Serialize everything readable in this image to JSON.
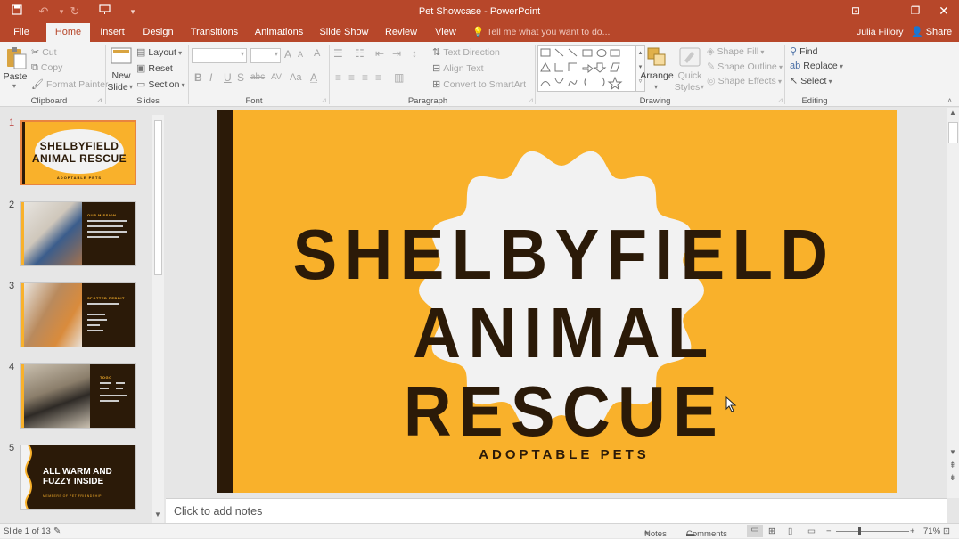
{
  "window": {
    "title": "Pet Showcase - PowerPoint",
    "minimize_glyph": "–",
    "restore_glyph": "❐",
    "close_glyph": "✕",
    "ribbon_options_glyph": "⊡"
  },
  "qat": {
    "save_icon": "save-icon",
    "undo_icon": "undo-icon",
    "redo_icon": "redo-icon",
    "present_icon": "present-from-start-icon",
    "customize_icon": "customize-qat-icon"
  },
  "tabs": [
    {
      "label": "File"
    },
    {
      "label": "Home",
      "active": true
    },
    {
      "label": "Insert"
    },
    {
      "label": "Design"
    },
    {
      "label": "Transitions"
    },
    {
      "label": "Animations"
    },
    {
      "label": "Slide Show"
    },
    {
      "label": "Review"
    },
    {
      "label": "View"
    }
  ],
  "tell_me": "Tell me what you want to do...",
  "user": "Julia Fillory",
  "share": "Share",
  "ribbon": {
    "clipboard": {
      "paste": "Paste",
      "cut": "Cut",
      "copy": "Copy",
      "format_painter": "Format Painter",
      "label": "Clipboard"
    },
    "slides": {
      "new_slide_1": "New",
      "new_slide_2": "Slide",
      "layout": "Layout",
      "reset": "Reset",
      "section": "Section",
      "label": "Slides"
    },
    "font": {
      "label": "Font",
      "bold": "B",
      "italic": "I",
      "underline": "U",
      "strike": "S",
      "shadow": "abc",
      "spacing": "AV",
      "case": "Aa",
      "clear": "A",
      "grow": "A",
      "shrink": "A",
      "color": "A"
    },
    "paragraph": {
      "label": "Paragraph",
      "text_direction": "Text Direction",
      "align_text": "Align Text",
      "smartart": "Convert to SmartArt"
    },
    "drawing": {
      "label": "Drawing",
      "arrange": "Arrange",
      "quick_styles_1": "Quick",
      "quick_styles_2": "Styles",
      "shape_fill": "Shape Fill",
      "shape_outline": "Shape Outline",
      "shape_effects": "Shape Effects"
    },
    "editing": {
      "label": "Editing",
      "find": "Find",
      "replace": "Replace",
      "select": "Select"
    }
  },
  "thumbnails": [
    {
      "number": "1",
      "title": "SHELBYFIELD ANIMAL RESCUE",
      "subtitle": "ADOPTABLE PETS"
    },
    {
      "number": "2",
      "heading": "OUR MISSION"
    },
    {
      "number": "3",
      "heading": "SPOTTED REDDIT"
    },
    {
      "number": "4",
      "heading": "TOGO"
    },
    {
      "number": "5",
      "title": "ALL WARM AND FUZZY INSIDE",
      "subtitle": "MEMBERS OF PET FRIENDSHIP"
    }
  ],
  "slide": {
    "title_line1": "SHELBYFIELD",
    "title_line2": "ANIMAL RESCUE",
    "subtitle": "ADOPTABLE PETS",
    "bg_color": "#f9b12b",
    "accent_color": "#2b1a08"
  },
  "notes_placeholder": "Click to add notes",
  "status": {
    "slide_counter": "Slide 1 of 13",
    "notes": "Notes",
    "comments": "Comments",
    "zoom": "71%"
  },
  "colors": {
    "brand": "#b7472a",
    "ribbon_bg": "#f3f3f3"
  }
}
